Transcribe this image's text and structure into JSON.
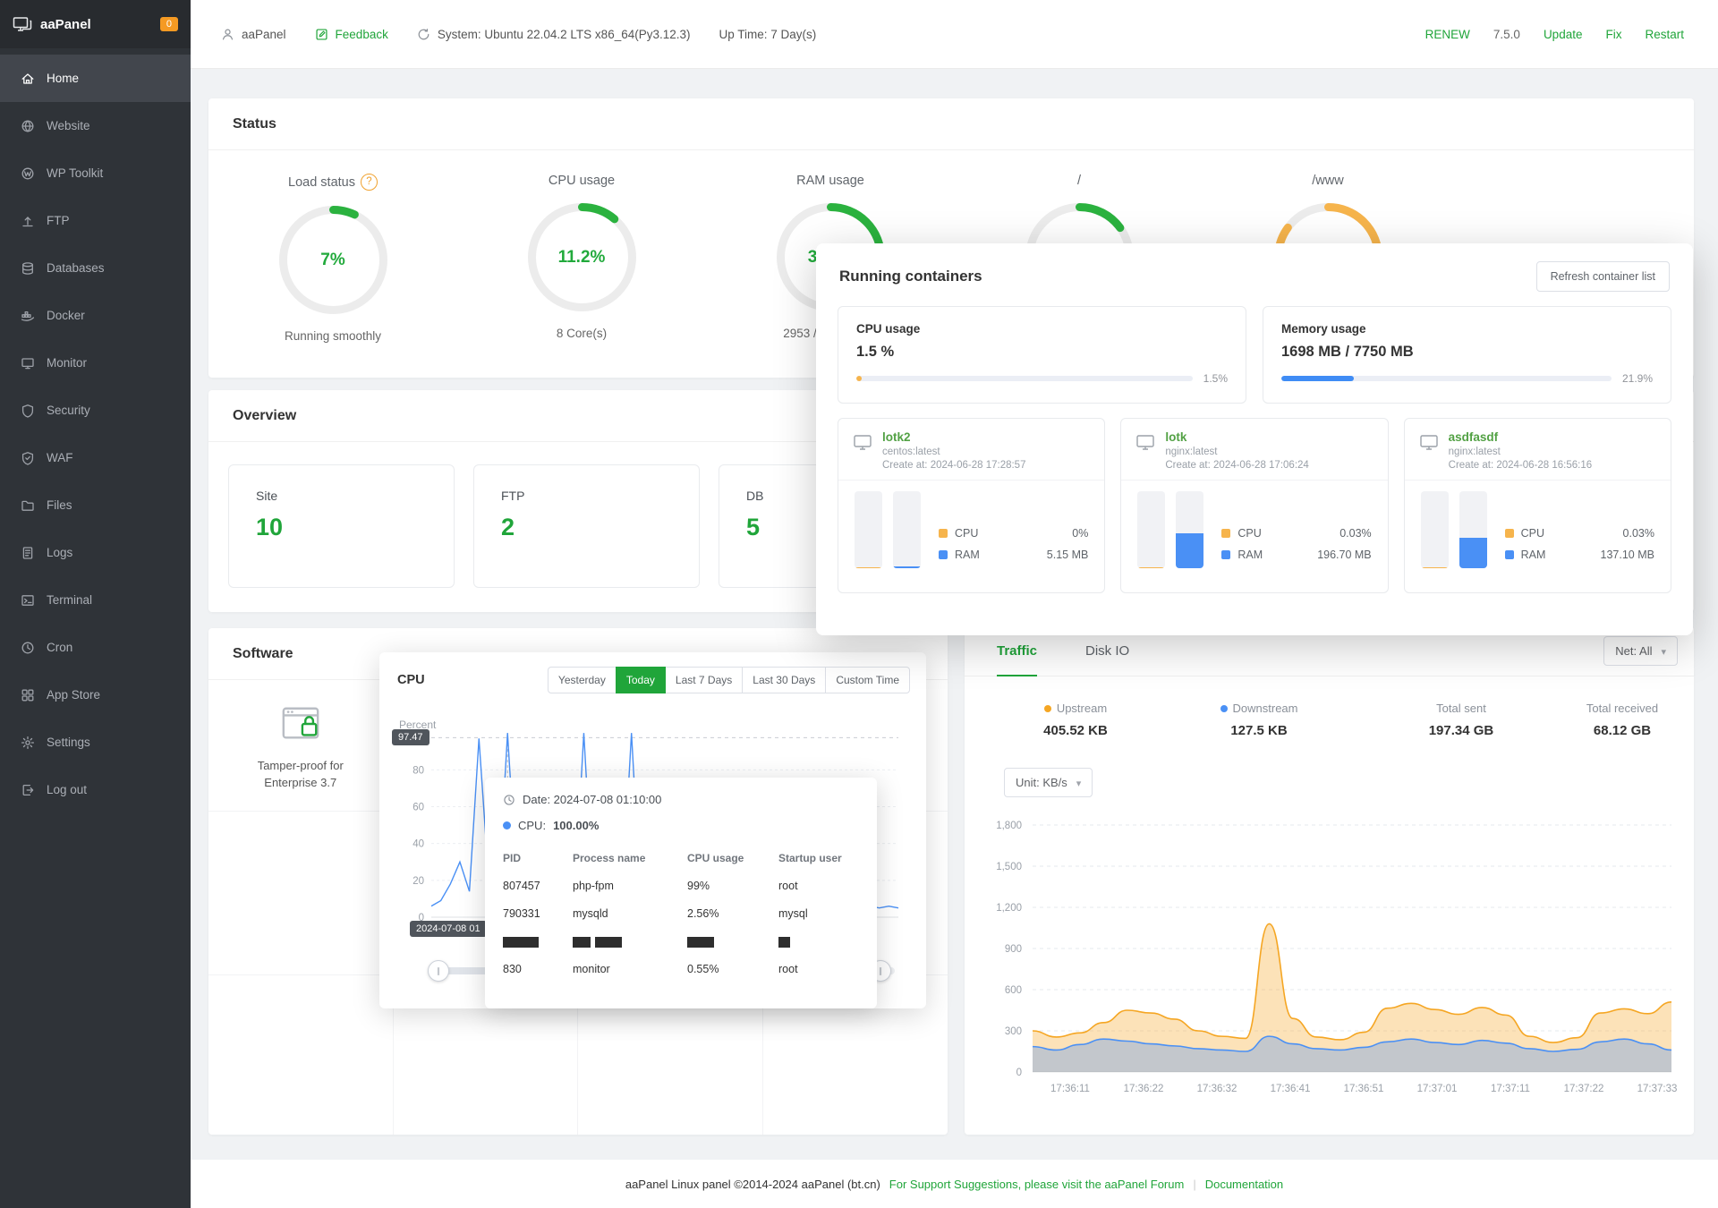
{
  "palette": {
    "green": "#20a53a",
    "arc_green": "#2bb23f",
    "orange": "#f6b44c",
    "blue": "#4a90f5",
    "mem_blue": "#3f8cf5",
    "badge_orange": "#f59a23",
    "container_name_green": "#52a144"
  },
  "sidebar": {
    "logo": "aaPanel",
    "badge": "0",
    "items": [
      {
        "label": "Home",
        "icon": "home"
      },
      {
        "label": "Website",
        "icon": "website"
      },
      {
        "label": "WP Toolkit",
        "icon": "wp"
      },
      {
        "label": "FTP",
        "icon": "ftp"
      },
      {
        "label": "Databases",
        "icon": "databases"
      },
      {
        "label": "Docker",
        "icon": "docker"
      },
      {
        "label": "Monitor",
        "icon": "monitor"
      },
      {
        "label": "Security",
        "icon": "security"
      },
      {
        "label": "WAF",
        "icon": "waf"
      },
      {
        "label": "Files",
        "icon": "files"
      },
      {
        "label": "Logs",
        "icon": "logs"
      },
      {
        "label": "Terminal",
        "icon": "terminal"
      },
      {
        "label": "Cron",
        "icon": "cron"
      },
      {
        "label": "App Store",
        "icon": "appstore"
      },
      {
        "label": "Settings",
        "icon": "settings"
      },
      {
        "label": "Log out",
        "icon": "logout"
      }
    ]
  },
  "topbar": {
    "account": "aaPanel",
    "feedback": "Feedback",
    "system": "System: Ubuntu 22.04.2 LTS x86_64(Py3.12.3)",
    "uptime": "Up Time: 7 Day(s)",
    "renew": "RENEW",
    "version": "7.5.0",
    "update": "Update",
    "fix": "Fix",
    "restart": "Restart"
  },
  "status": {
    "title": "Status",
    "gauges": [
      {
        "title": "Load status",
        "value": "7%",
        "caption": "Running smoothly",
        "percent": 7,
        "color": "green"
      },
      {
        "title": "CPU usage",
        "value": "11.2%",
        "caption": "8 Core(s)",
        "percent": 11.2,
        "color": "green"
      },
      {
        "title": "RAM usage",
        "value": "3",
        "caption": "2953 /",
        "percent": 38,
        "color": "green"
      },
      {
        "title": "/",
        "value": "",
        "caption": "",
        "percent": 15,
        "color": "green"
      },
      {
        "title": "/www",
        "value": "",
        "caption": "",
        "percent": 85,
        "color": "orange"
      }
    ]
  },
  "overview": {
    "title": "Overview",
    "items": [
      {
        "label": "Site",
        "value": "10"
      },
      {
        "label": "FTP",
        "value": "2"
      },
      {
        "label": "DB",
        "value": "5"
      }
    ]
  },
  "software": {
    "title": "Software",
    "item": {
      "line1": "Tamper-proof for",
      "line2": "Enterprise 3.7"
    }
  },
  "containers": {
    "title": "Running containers",
    "refresh": "Refresh container list",
    "cpu_label": "CPU usage",
    "cpu_value": "1.5 %",
    "cpu_pct_label": "1.5%",
    "cpu_pct": 1.5,
    "mem_label": "Memory usage",
    "mem_value": "1698 MB / 7750 MB",
    "mem_pct_label": "21.9%",
    "mem_pct": 21.9,
    "cards": [
      {
        "name": "lotk2",
        "image": "centos:latest",
        "created": "Create at: 2024-06-28 17:28:57",
        "cpu_label": "CPU",
        "cpu": "0%",
        "ram_label": "RAM",
        "ram": "5.15 MB",
        "cpu_bar": 1,
        "ram_bar": 2
      },
      {
        "name": "lotk",
        "image": "nginx:latest",
        "created": "Create at: 2024-06-28 17:06:24",
        "cpu_label": "CPU",
        "cpu": "0.03%",
        "ram_label": "RAM",
        "ram": "196.70 MB",
        "cpu_bar": 1,
        "ram_bar": 45
      },
      {
        "name": "asdfasdf",
        "image": "nginx:latest",
        "created": "Create at: 2024-06-28 16:56:16",
        "cpu_label": "CPU",
        "cpu": "0.03%",
        "ram_label": "RAM",
        "ram": "137.10 MB",
        "cpu_bar": 1,
        "ram_bar": 40
      }
    ]
  },
  "cpu_window": {
    "title": "CPU",
    "tabs": [
      "Yesterday",
      "Today",
      "Last 7 Days",
      "Last 30 Days",
      "Custom Time"
    ],
    "active_tab": "Today"
  },
  "tooltip": {
    "date": "Date: 2024-07-08 01:10:00",
    "cpu_label": "CPU:",
    "cpu_value": "100.00%",
    "headers": [
      "PID",
      "Process name",
      "CPU usage",
      "Startup user"
    ],
    "rows": [
      {
        "pid": "807457",
        "process": "php-fpm",
        "cpu": "99%",
        "user": "root"
      },
      {
        "pid": "790331",
        "process": "mysqld",
        "cpu": "2.56%",
        "user": "mysql"
      },
      {
        "redacted": true
      },
      {
        "pid": "830",
        "process": "monitor",
        "cpu": "0.55%",
        "user": "root"
      }
    ]
  },
  "traffic": {
    "tabs": [
      "Traffic",
      "Disk IO"
    ],
    "net_select": "Net: All",
    "unit_select": "Unit: KB/s",
    "stats": [
      {
        "label": "Upstream",
        "value": "405.52 KB",
        "dot": "#f5a623"
      },
      {
        "label": "Downstream",
        "value": "127.5 KB",
        "dot": "#4a90f5"
      },
      {
        "label": "Total sent",
        "value": "197.34 GB"
      },
      {
        "label": "Total received",
        "value": "68.12 GB"
      }
    ]
  },
  "footer": {
    "copyright": "aaPanel Linux panel ©2014-2024 aaPanel (bt.cn)",
    "support": "For Support Suggestions, please visit the aaPanel Forum",
    "divider": "|",
    "docs": "Documentation"
  },
  "chart_data": [
    {
      "id": "cpu",
      "type": "line",
      "title": "CPU",
      "ylabel": "Percent",
      "yticks": [
        0,
        20,
        40,
        60,
        80
      ],
      "ymax_line": 97.47,
      "ymax_label": "97.47",
      "ylim": [
        0,
        103
      ],
      "x_axis_badge": "2024-07-08 01",
      "series": [
        {
          "name": "CPU",
          "color": "#4a90f5",
          "values": [
            6,
            9,
            18,
            30,
            14,
            97,
            22,
            10,
            100,
            15,
            8,
            20,
            12,
            6,
            5,
            7,
            100,
            8,
            6,
            5,
            7,
            100,
            6,
            5,
            7,
            6,
            5,
            6,
            7,
            6,
            5,
            6,
            6,
            7,
            5,
            6,
            7,
            5,
            6,
            6,
            5,
            7,
            6,
            5,
            6,
            7,
            6,
            5,
            6,
            5
          ]
        }
      ]
    },
    {
      "id": "traffic",
      "type": "area",
      "yticks": [
        0,
        300,
        600,
        900,
        1200,
        1500,
        1800
      ],
      "ytick_labels": [
        "0",
        "300",
        "600",
        "900",
        "1,200",
        "1,500",
        "1,800"
      ],
      "ylim": [
        0,
        1800
      ],
      "xticks": [
        "17:36:11",
        "17:36:22",
        "17:36:32",
        "17:36:41",
        "17:36:51",
        "17:37:01",
        "17:37:11",
        "17:37:22",
        "17:37:33"
      ],
      "series": [
        {
          "name": "Upstream",
          "color": "#f5a623",
          "values": [
            300,
            255,
            285,
            360,
            450,
            430,
            385,
            300,
            260,
            245,
            1080,
            390,
            255,
            235,
            290,
            465,
            500,
            455,
            420,
            470,
            415,
            260,
            215,
            250,
            430,
            460,
            425,
            510
          ]
        },
        {
          "name": "Downstream",
          "color": "#4a90f5",
          "values": [
            185,
            160,
            200,
            240,
            225,
            205,
            190,
            170,
            160,
            150,
            260,
            205,
            170,
            160,
            180,
            220,
            240,
            215,
            200,
            230,
            210,
            170,
            150,
            165,
            220,
            240,
            205,
            160
          ]
        }
      ]
    }
  ]
}
